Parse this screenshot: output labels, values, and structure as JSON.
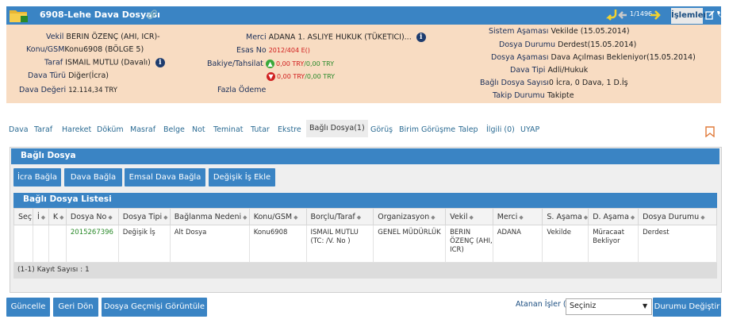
{
  "header": {
    "title": "6908-Lehe Dava Dosyası",
    "pager": "1/1496",
    "menu_label": "İşlemler"
  },
  "info": {
    "vekil_label": "Vekil",
    "vekil_value": "BERIN ÖZENÇ (AHI, ICR)-",
    "konu_label": "Konu/GSM",
    "konu_value": "Konu6908 (BÖLGE 5)",
    "taraf_label": "Taraf",
    "taraf_value": "ISMAIL MUTLU (Davalı)",
    "dava_turu_label": "Dava Türü",
    "dava_turu_value": "Diğer(İcra)",
    "dava_degeri_label": "Dava Değeri",
    "dava_degeri_value": "12.114,34 TRY",
    "merci_label": "Merci",
    "merci_value": "ADANA 1. ASLIYE HUKUK (TÜKETICI)...",
    "esas_no_label": "Esas No",
    "esas_no_value": "2012/404 E()",
    "bakiye_label": "Bakiye/Tahsilat",
    "bakiye_up_red": "0,00 TRY",
    "bakiye_up_green": "0,00 TRY",
    "bakiye_down_red": "0,00 TRY",
    "bakiye_down_green": "0,00 TRY",
    "fazla_odeme_label": "Fazla Ödeme",
    "sistem_asamasi_label": "Sistem Aşaması",
    "sistem_asamasi_value": "Vekilde (15.05.2014)",
    "dosya_durumu_label": "Dosya Durumu",
    "dosya_durumu_value": "Derdest(15.05.2014)",
    "dosya_asamasi_label": "Dosya Aşaması",
    "dosya_asamasi_value": "Dava Açılması Bekleniyor(15.05.2014)",
    "dava_tipi_label": "Dava Tipi",
    "dava_tipi_value": "Adli/Hukuk",
    "bagli_sayisi_label": "Bağlı Dosya Sayısı",
    "bagli_sayisi_value": "0 İcra, 0 Dava, 1 D.İş",
    "takip_durumu_label": "Takip Durumu",
    "takip_durumu_value": "Takipte"
  },
  "tabs": [
    "Dava",
    "Taraf",
    "Hareket",
    "Döküm",
    "Masraf",
    "Belge",
    "Not",
    "Teminat",
    "Tutar",
    "Ekstre",
    "Bağlı Dosya(1)",
    "Görüş",
    "Birim Görüşme",
    "Talep",
    "İlgili (0)",
    "UYAP"
  ],
  "panel": {
    "title": "Bağlı Dosya",
    "buttons": [
      "İcra Bağla",
      "Dava Bağla",
      "Emsal Dava Bağla",
      "Değişik İş Ekle"
    ],
    "list_title": "Bağlı Dosya Listesi",
    "columns": [
      "Seç",
      "İ",
      "K",
      "Dosya No",
      "Dosya Tipi",
      "Bağlanma Nedeni",
      "Konu/GSM",
      "Borçlu/Taraf",
      "Organizasyon",
      "Vekil",
      "Merci",
      "S. Aşama",
      "D. Aşama",
      "Dosya Durumu"
    ],
    "rows": [
      [
        "",
        "",
        "",
        "2015267396",
        "Değişik İş",
        "Alt Dosya",
        "Konu6908",
        "ISMAIL MUTLU (TC: /V. No )",
        "GENEL MÜDÜRLÜK",
        "BERIN ÖZENÇ (AHI, ICR)",
        "ADANA",
        "Vekilde",
        "Müracaat Bekliyor",
        "Derdest"
      ]
    ],
    "record_count": "(1-1) Kayıt Sayısı : 1"
  },
  "footer": {
    "buttons": [
      "Güncelle",
      "Geri Dön",
      "Dosya Geçmişi Görüntüle"
    ],
    "atanan_label": "Atanan İşler (*)",
    "select_value": "Seçiniz",
    "change_button": "Durumu Değiştir"
  },
  "colors": {
    "accent": "#3a84c4",
    "info_bg": "#f8dcc2",
    "link_green": "#2a8a2a",
    "alert_red": "#d01c1c"
  }
}
